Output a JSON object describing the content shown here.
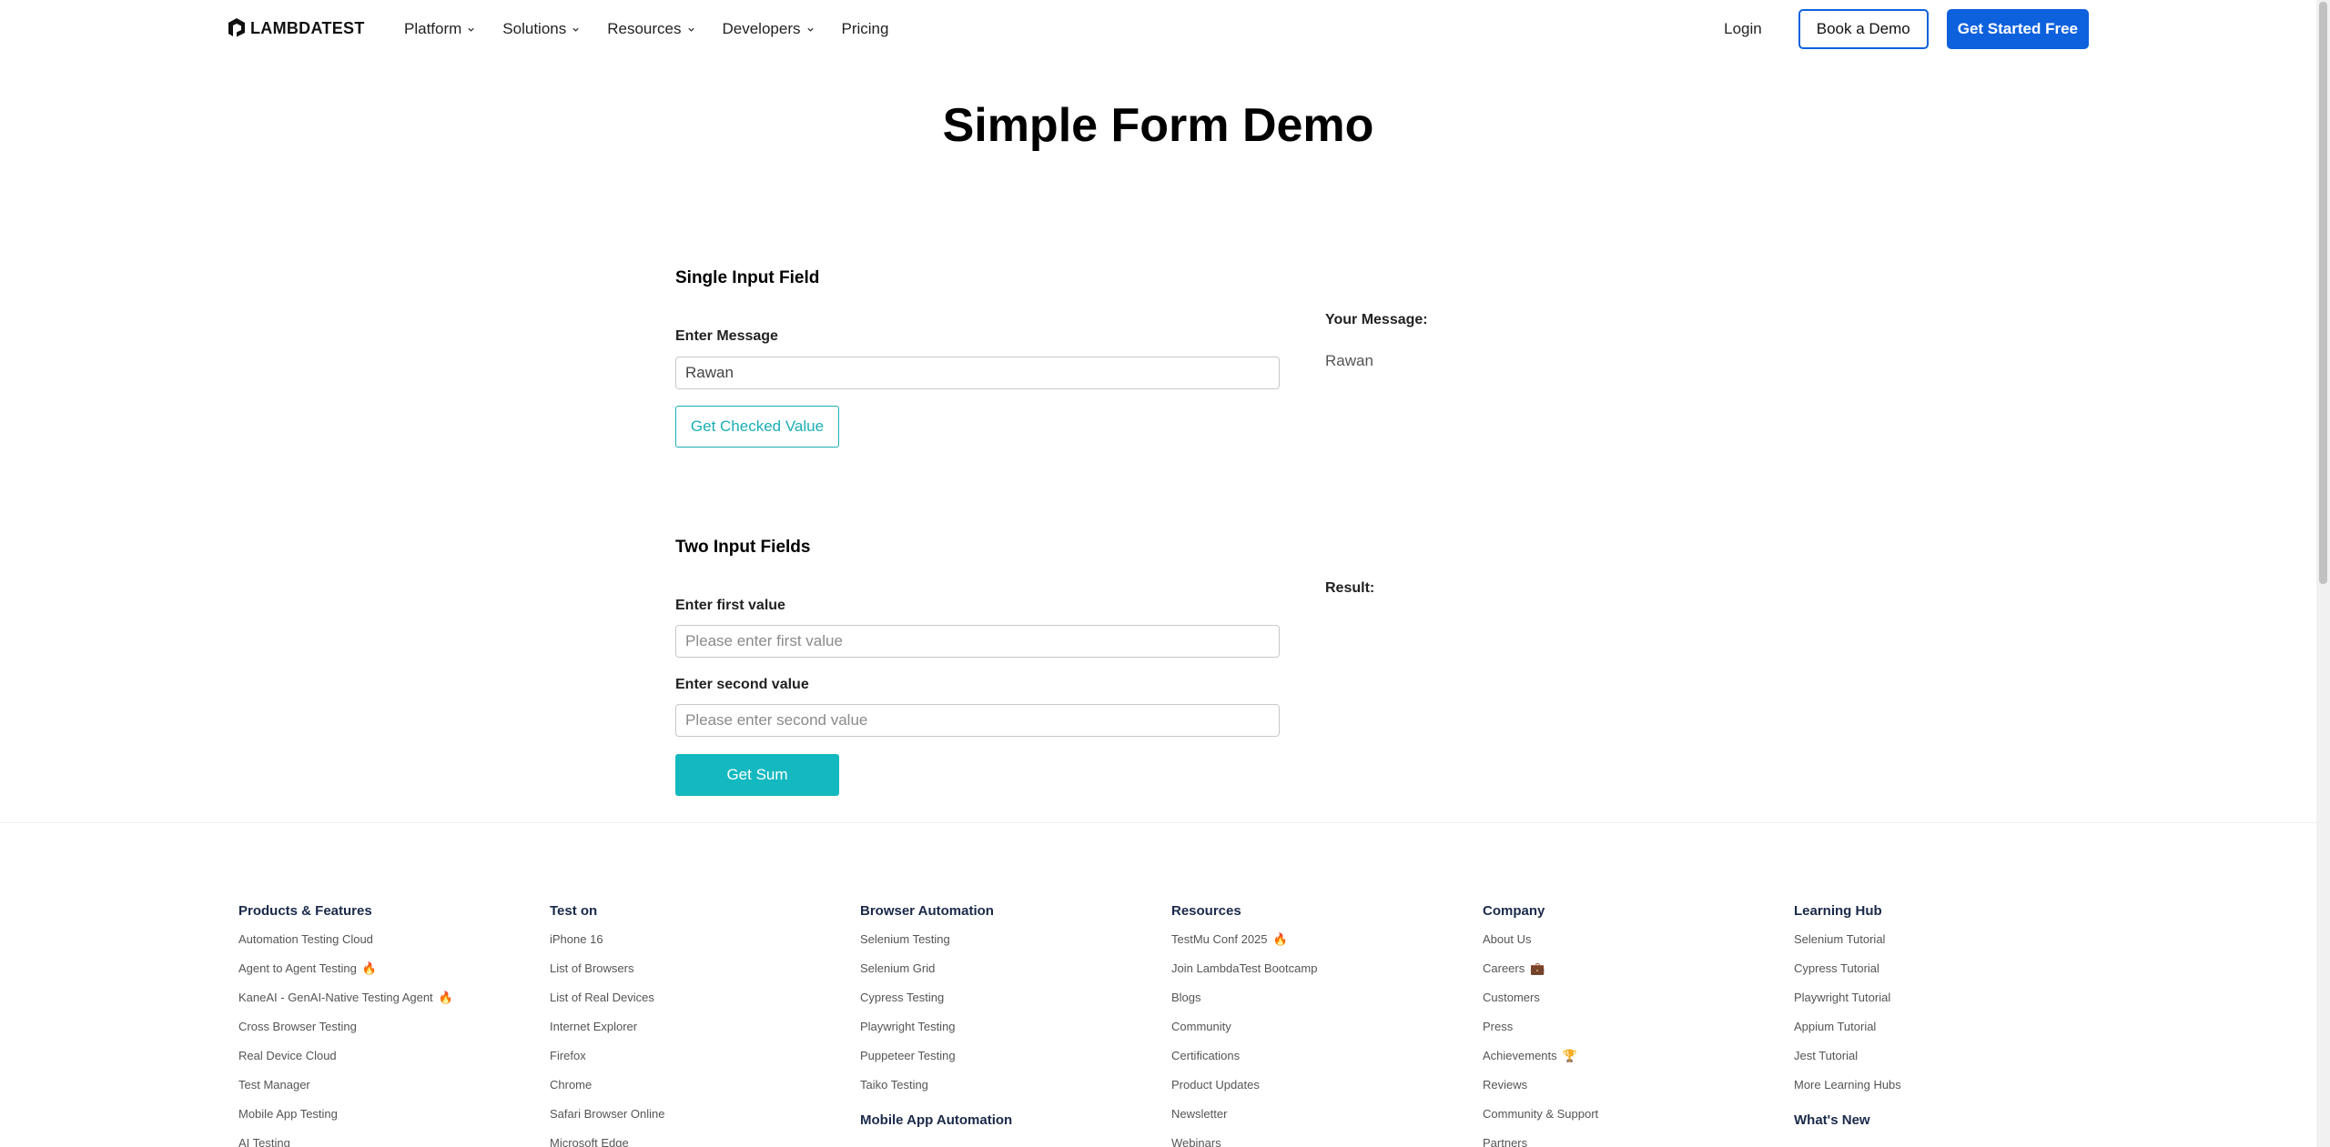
{
  "header": {
    "logo_text": "LAMBDATEST",
    "nav": [
      {
        "label": "Platform",
        "dropdown": true
      },
      {
        "label": "Solutions",
        "dropdown": true
      },
      {
        "label": "Resources",
        "dropdown": true
      },
      {
        "label": "Developers",
        "dropdown": true
      },
      {
        "label": "Pricing",
        "dropdown": false
      }
    ],
    "login_label": "Login",
    "book_demo_label": "Book a Demo",
    "get_started_label": "Get Started Free"
  },
  "main": {
    "title": "Simple Form Demo",
    "single": {
      "section_title": "Single Input Field",
      "label": "Enter Message",
      "value": "Rawan",
      "button_label": "Get Checked Value",
      "result_label": "Your Message:",
      "result_value": "Rawan"
    },
    "two": {
      "section_title": "Two Input Fields",
      "first_label": "Enter first value",
      "first_placeholder": "Please enter first value",
      "second_label": "Enter second value",
      "second_placeholder": "Please enter second value",
      "button_label": "Get Sum",
      "result_label": "Result:"
    }
  },
  "footer": {
    "columns": [
      {
        "heading": "Products & Features",
        "links": [
          {
            "text": "Automation Testing Cloud",
            "emoji": ""
          },
          {
            "text": "Agent to Agent Testing",
            "emoji": "🔥"
          },
          {
            "text": "KaneAI - GenAI-Native Testing Agent",
            "emoji": "🔥"
          },
          {
            "text": "Cross Browser Testing",
            "emoji": ""
          },
          {
            "text": "Real Device Cloud",
            "emoji": ""
          },
          {
            "text": "Test Manager",
            "emoji": ""
          },
          {
            "text": "Mobile App Testing",
            "emoji": ""
          },
          {
            "text": "AI Testing",
            "emoji": ""
          }
        ],
        "sub_heading": ""
      },
      {
        "heading": "Test on",
        "links": [
          {
            "text": "iPhone 16",
            "emoji": ""
          },
          {
            "text": "List of Browsers",
            "emoji": ""
          },
          {
            "text": "List of Real Devices",
            "emoji": ""
          },
          {
            "text": "Internet Explorer",
            "emoji": ""
          },
          {
            "text": "Firefox",
            "emoji": ""
          },
          {
            "text": "Chrome",
            "emoji": ""
          },
          {
            "text": "Safari Browser Online",
            "emoji": ""
          },
          {
            "text": "Microsoft Edge",
            "emoji": ""
          }
        ],
        "sub_heading": ""
      },
      {
        "heading": "Browser Automation",
        "links": [
          {
            "text": "Selenium Testing",
            "emoji": ""
          },
          {
            "text": "Selenium Grid",
            "emoji": ""
          },
          {
            "text": "Cypress Testing",
            "emoji": ""
          },
          {
            "text": "Playwright Testing",
            "emoji": ""
          },
          {
            "text": "Puppeteer Testing",
            "emoji": ""
          },
          {
            "text": "Taiko Testing",
            "emoji": ""
          }
        ],
        "sub_heading": "Mobile App Automation"
      },
      {
        "heading": "Resources",
        "links": [
          {
            "text": "TestMu Conf 2025",
            "emoji": "🔥"
          },
          {
            "text": "Join LambdaTest Bootcamp",
            "emoji": ""
          },
          {
            "text": "Blogs",
            "emoji": ""
          },
          {
            "text": "Community",
            "emoji": ""
          },
          {
            "text": "Certifications",
            "emoji": ""
          },
          {
            "text": "Product Updates",
            "emoji": ""
          },
          {
            "text": "Newsletter",
            "emoji": ""
          },
          {
            "text": "Webinars",
            "emoji": ""
          }
        ],
        "sub_heading": ""
      },
      {
        "heading": "Company",
        "links": [
          {
            "text": "About Us",
            "emoji": ""
          },
          {
            "text": "Careers",
            "emoji": "💼"
          },
          {
            "text": "Customers",
            "emoji": ""
          },
          {
            "text": "Press",
            "emoji": ""
          },
          {
            "text": "Achievements",
            "emoji": "🏆"
          },
          {
            "text": "Reviews",
            "emoji": ""
          },
          {
            "text": "Community & Support",
            "emoji": ""
          },
          {
            "text": "Partners",
            "emoji": ""
          }
        ],
        "sub_heading": ""
      },
      {
        "heading": "Learning Hub",
        "links": [
          {
            "text": "Selenium Tutorial",
            "emoji": ""
          },
          {
            "text": "Cypress Tutorial",
            "emoji": ""
          },
          {
            "text": "Playwright Tutorial",
            "emoji": ""
          },
          {
            "text": "Appium Tutorial",
            "emoji": ""
          },
          {
            "text": "Jest Tutorial",
            "emoji": ""
          },
          {
            "text": "More Learning Hubs",
            "emoji": ""
          }
        ],
        "sub_heading": "What's New"
      }
    ]
  },
  "colors": {
    "brand_blue": "#0e61dd",
    "teal": "#14b8bf"
  }
}
